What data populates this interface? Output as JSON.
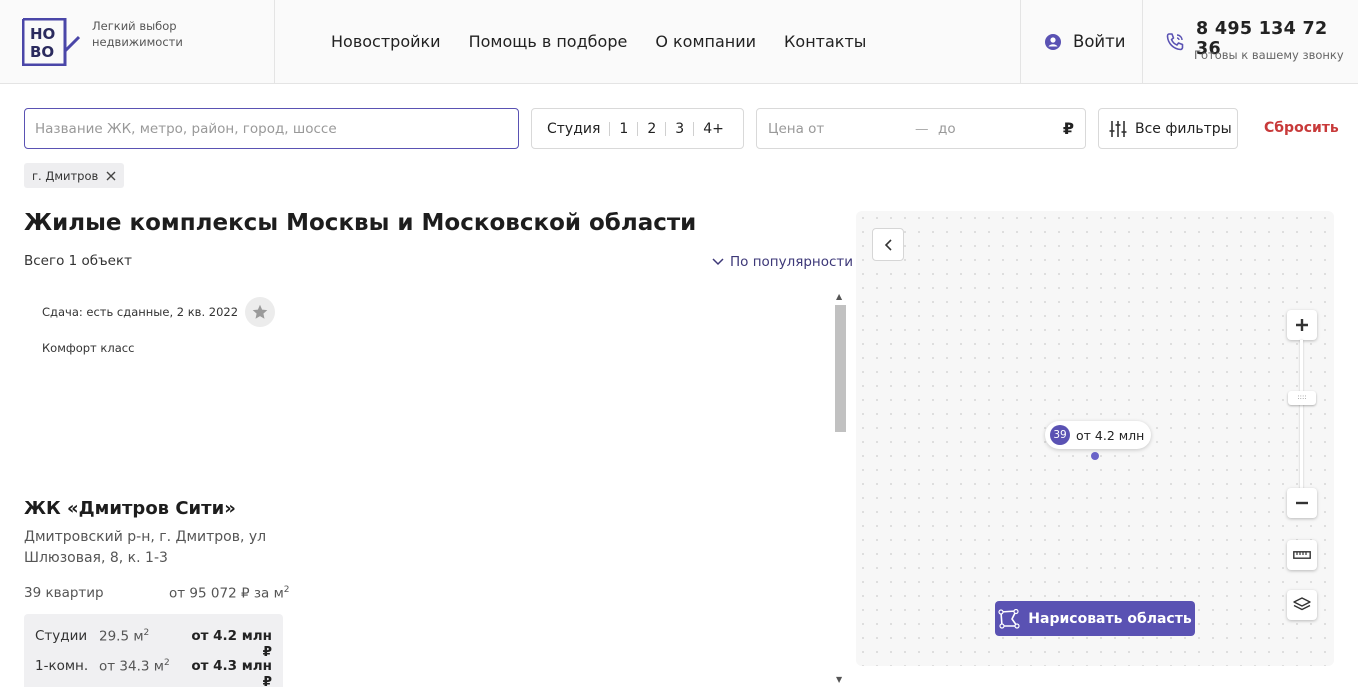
{
  "brand": {
    "logo_line1": "НО",
    "logo_line2": "ВО",
    "tagline": "Легкий выбор недвижимости",
    "accent_color": "#5a52b3"
  },
  "nav": {
    "items": [
      {
        "label": "Новостройки"
      },
      {
        "label": "Помощь в подборе"
      },
      {
        "label": "О компании"
      },
      {
        "label": "Контакты"
      }
    ],
    "login_label": "Войти",
    "phone": "8 495 134 72 36",
    "phone_caption": "Готовы к вашему звонку"
  },
  "filters": {
    "search_placeholder": "Название ЖК, метро, район, город, шоссе",
    "rooms": [
      "Студия",
      "1",
      "2",
      "3",
      "4+"
    ],
    "price_from_placeholder": "Цена от",
    "price_dash": "—",
    "price_to_placeholder": "до",
    "currency": "₽",
    "all_filters_label": "Все фильтры",
    "reset_label": "Сбросить",
    "active_chip": "г. Дмитров"
  },
  "listing": {
    "title": "Жилые комплексы Москвы и Московской области",
    "total": "Всего 1 объект",
    "sort_label": "По популярности"
  },
  "card": {
    "delivery": "Сдача: есть сданные, 2 кв. 2022",
    "class": "Комфорт класс",
    "name": "ЖК «Дмитров Сити»",
    "address": "Дмитровский р-н, г. Дмитров, ул Шлюзовая, 8, к. 1-3",
    "flats": "39 квартир",
    "price_per_m2": "от 95 072 ₽ за м",
    "price_per_m2_sup": "2",
    "rows": [
      {
        "type": "Студии",
        "area": "29.5 м",
        "area_sup": "2",
        "price": "от 4.2 млн ₽"
      },
      {
        "type": "1-комн.",
        "area": "от 34.3 м",
        "area_sup": "2",
        "price": "от 4.3 млн ₽"
      }
    ]
  },
  "map": {
    "marker_count": "39",
    "marker_price": "от 4.2 млн",
    "zoom_in": "+",
    "zoom_out": "−",
    "draw_label": "Нарисовать область"
  }
}
